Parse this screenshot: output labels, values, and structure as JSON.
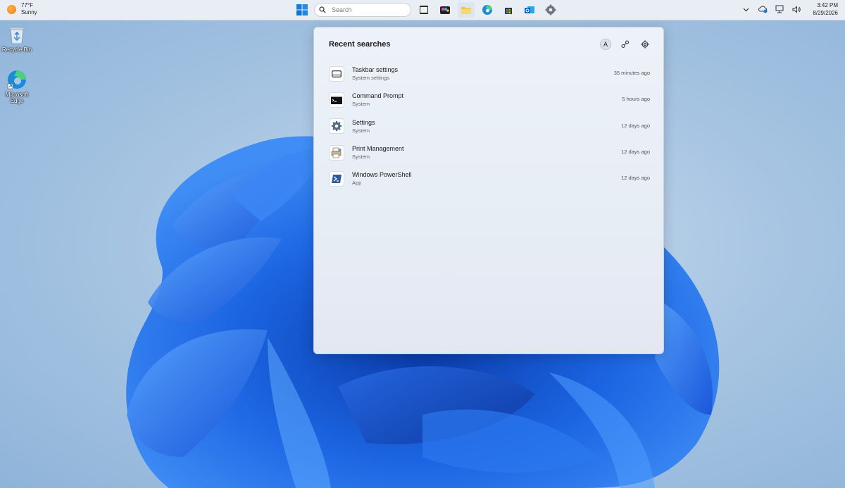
{
  "weather": {
    "temp": "77°F",
    "condition": "Sunny"
  },
  "taskbar": {
    "search_placeholder": "Search",
    "apps": [
      "terminal-icon",
      "store-beta-icon",
      "file-explorer-icon",
      "edge-icon",
      "microsoft-store-icon",
      "outlook-icon",
      "settings-icon"
    ]
  },
  "clock": {
    "time": "3:42 PM",
    "date": "8/29/2026"
  },
  "desktop": {
    "icons": [
      {
        "label": "Recycle Bin",
        "icon": "recycle-bin-icon"
      },
      {
        "label": "Microsoft Edge",
        "icon": "edge-icon"
      }
    ]
  },
  "panel": {
    "title": "Recent searches",
    "avatar_letter": "A",
    "results": [
      {
        "title": "Taskbar settings",
        "subtitle": "System settings",
        "time": "35 minutes ago",
        "icon": "taskbar-icon"
      },
      {
        "title": "Command Prompt",
        "subtitle": "System",
        "time": "5 hours ago",
        "icon": "command-prompt-icon"
      },
      {
        "title": "Settings",
        "subtitle": "System",
        "time": "12 days ago",
        "icon": "gear-icon"
      },
      {
        "title": "Print Management",
        "subtitle": "System",
        "time": "12 days ago",
        "icon": "print-management-icon"
      },
      {
        "title": "Windows PowerShell",
        "subtitle": "App",
        "time": "12 days ago",
        "icon": "powershell-icon"
      }
    ]
  },
  "colors": {
    "accent": "#0a63d6",
    "wallpaper_blue": "#1e6fe6"
  }
}
